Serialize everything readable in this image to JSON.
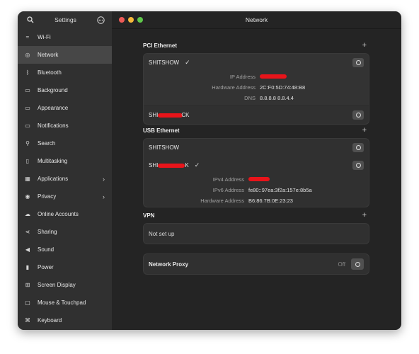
{
  "sidebar": {
    "title": "Settings",
    "search_icon": "search-icon",
    "menu_icon": "more-icon",
    "items": [
      {
        "label": "Wi-Fi",
        "icon": "wifi-icon",
        "glyph": "≈"
      },
      {
        "label": "Network",
        "icon": "network-icon",
        "glyph": "◎",
        "active": true
      },
      {
        "label": "Bluetooth",
        "icon": "bluetooth-icon",
        "glyph": "ᛒ"
      },
      {
        "label": "Background",
        "icon": "background-icon",
        "glyph": "▭"
      },
      {
        "label": "Appearance",
        "icon": "appearance-icon",
        "glyph": "▭"
      },
      {
        "label": "Notifications",
        "icon": "notifications-icon",
        "glyph": "▭"
      },
      {
        "label": "Search",
        "icon": "search-icon",
        "glyph": "⚲"
      },
      {
        "label": "Multitasking",
        "icon": "multitasking-icon",
        "glyph": "▯"
      },
      {
        "label": "Applications",
        "icon": "applications-icon",
        "glyph": "▦",
        "chevron": true
      },
      {
        "label": "Privacy",
        "icon": "privacy-icon",
        "glyph": "◉",
        "chevron": true
      },
      {
        "label": "Online Accounts",
        "icon": "cloud-icon",
        "glyph": "☁"
      },
      {
        "label": "Sharing",
        "icon": "sharing-icon",
        "glyph": "⋖"
      },
      {
        "label": "Sound",
        "icon": "sound-icon",
        "glyph": "◀"
      },
      {
        "label": "Power",
        "icon": "power-icon",
        "glyph": "▮"
      },
      {
        "label": "Screen Display",
        "icon": "display-icon",
        "glyph": "⊞"
      },
      {
        "label": "Mouse & Touchpad",
        "icon": "mouse-icon",
        "glyph": "▢"
      },
      {
        "label": "Keyboard",
        "icon": "keyboard-icon",
        "glyph": "⌘"
      }
    ]
  },
  "window": {
    "title": "Network",
    "controls": {
      "close": "#ed5b57",
      "minimize": "#f6b83a",
      "maximize": "#5fc84a"
    }
  },
  "pci": {
    "title": "PCI Ethernet",
    "connections": [
      {
        "name": "SHITSHOW",
        "connected": true,
        "details": [
          {
            "label": "IP Address",
            "value": "[redacted]"
          },
          {
            "label": "Hardware Address",
            "value": "2C:F0:5D:74:48:B8"
          },
          {
            "label": "DNS",
            "value": "8.8.8.8 8.8.4.4"
          }
        ]
      },
      {
        "name_prefix": "SHI",
        "name_suffix": "CK",
        "connected": false
      }
    ]
  },
  "usb": {
    "title": "USB Ethernet",
    "connections": [
      {
        "name": "SHITSHOW",
        "connected": false
      },
      {
        "name_prefix": "SHI",
        "name_suffix": "K",
        "connected": true,
        "details": [
          {
            "label": "IPv4 Address",
            "value": "[redacted]"
          },
          {
            "label": "IPv6 Address",
            "value": "fe80::97ea:3f2a:157e:8b5a"
          },
          {
            "label": "Hardware Address",
            "value": "B6:86:7B:0E:23:23"
          }
        ]
      }
    ]
  },
  "vpn": {
    "title": "VPN",
    "status": "Not set up"
  },
  "proxy": {
    "title": "Network Proxy",
    "status": "Off"
  },
  "colors": {
    "redaction": "#e8141a",
    "active_item": "#474747"
  }
}
